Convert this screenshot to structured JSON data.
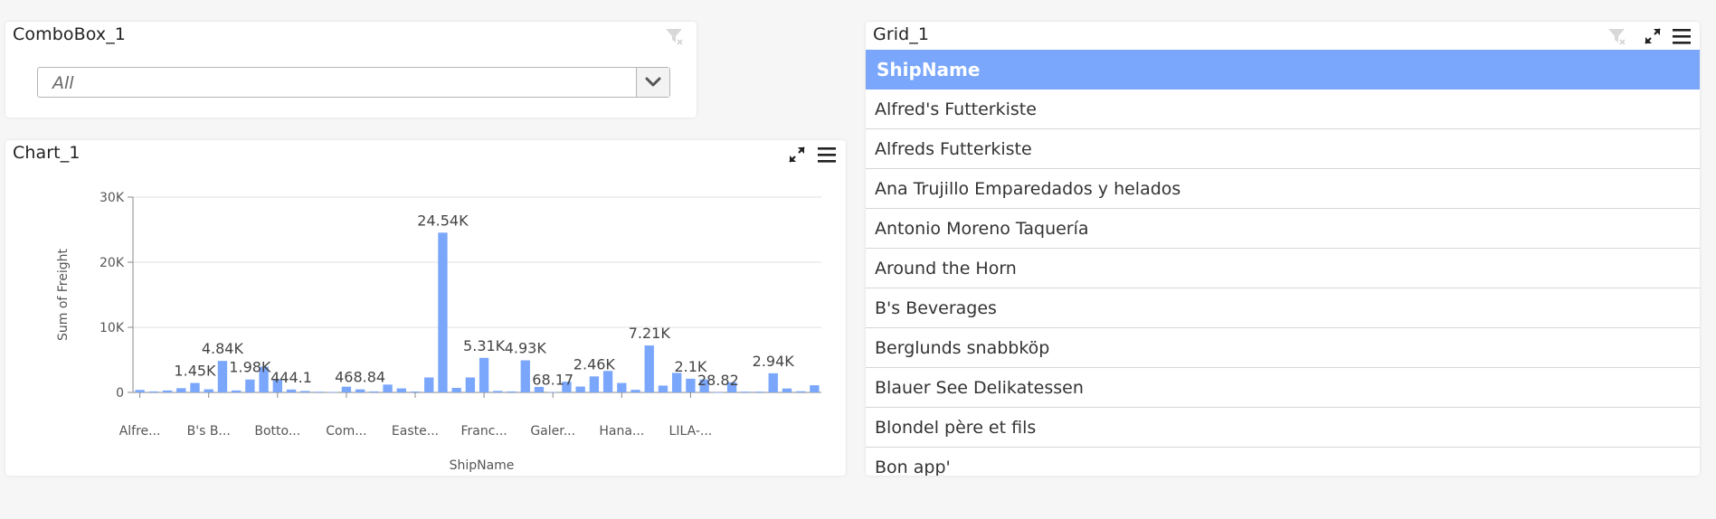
{
  "combo": {
    "title": "ComboBox_1",
    "value": "All"
  },
  "chart": {
    "title": "Chart_1"
  },
  "grid": {
    "title": "Grid_1",
    "column_header": "ShipName",
    "rows": [
      "Alfred's Futterkiste",
      "Alfreds Futterkiste",
      "Ana Trujillo Emparedados y helados",
      "Antonio Moreno Taquería",
      "Around the Horn",
      "B's Beverages",
      "Berglunds snabbköp",
      "Blauer See Delikatessen",
      "Blondel père et fils",
      "Bon app'"
    ]
  },
  "colors": {
    "accent": "#7aa7fb",
    "bar": "#7aa7fb"
  },
  "chart_data": {
    "type": "bar",
    "xlabel": "ShipName",
    "ylabel": "Sum of Freight",
    "ylim": [
      0,
      30000
    ],
    "yticks": [
      "0",
      "10K",
      "20K",
      "30K"
    ],
    "ytick_values": [
      0,
      10000,
      20000,
      30000
    ],
    "category_tick_labels": [
      "Alfre...",
      "B's B...",
      "Botto...",
      "Com...",
      "Easte...",
      "Franc...",
      "Galer...",
      "Hana...",
      "LILA-..."
    ],
    "category_tick_label_indices": [
      0,
      5,
      10,
      15,
      20,
      25,
      30,
      35,
      40
    ],
    "values": [
      380,
      150,
      300,
      650,
      1450,
      480,
      4840,
      300,
      1980,
      3950,
      2000,
      444.1,
      220,
      110,
      70,
      880,
      468.84,
      150,
      1200,
      620,
      140,
      2300,
      24540,
      700,
      2300,
      5310,
      230,
      150,
      4930,
      850,
      68.17,
      1650,
      900,
      2460,
      3300,
      1450,
      400,
      7210,
      1050,
      3000,
      2100,
      2000,
      28.82,
      1550,
      120,
      120,
      2940,
      600,
      180,
      1100
    ],
    "data_labels": [
      {
        "index": 4,
        "text": "1.45K"
      },
      {
        "index": 6,
        "text": "4.84K"
      },
      {
        "index": 8,
        "text": "1.98K"
      },
      {
        "index": 11,
        "text": "444.1"
      },
      {
        "index": 16,
        "text": "468.84"
      },
      {
        "index": 22,
        "text": "24.54K"
      },
      {
        "index": 25,
        "text": "5.31K"
      },
      {
        "index": 28,
        "text": "4.93K"
      },
      {
        "index": 30,
        "text": "68.17"
      },
      {
        "index": 33,
        "text": "2.46K"
      },
      {
        "index": 37,
        "text": "7.21K"
      },
      {
        "index": 40,
        "text": "2.1K"
      },
      {
        "index": 42,
        "text": "28.82"
      },
      {
        "index": 46,
        "text": "2.94K"
      }
    ],
    "grid": true
  }
}
